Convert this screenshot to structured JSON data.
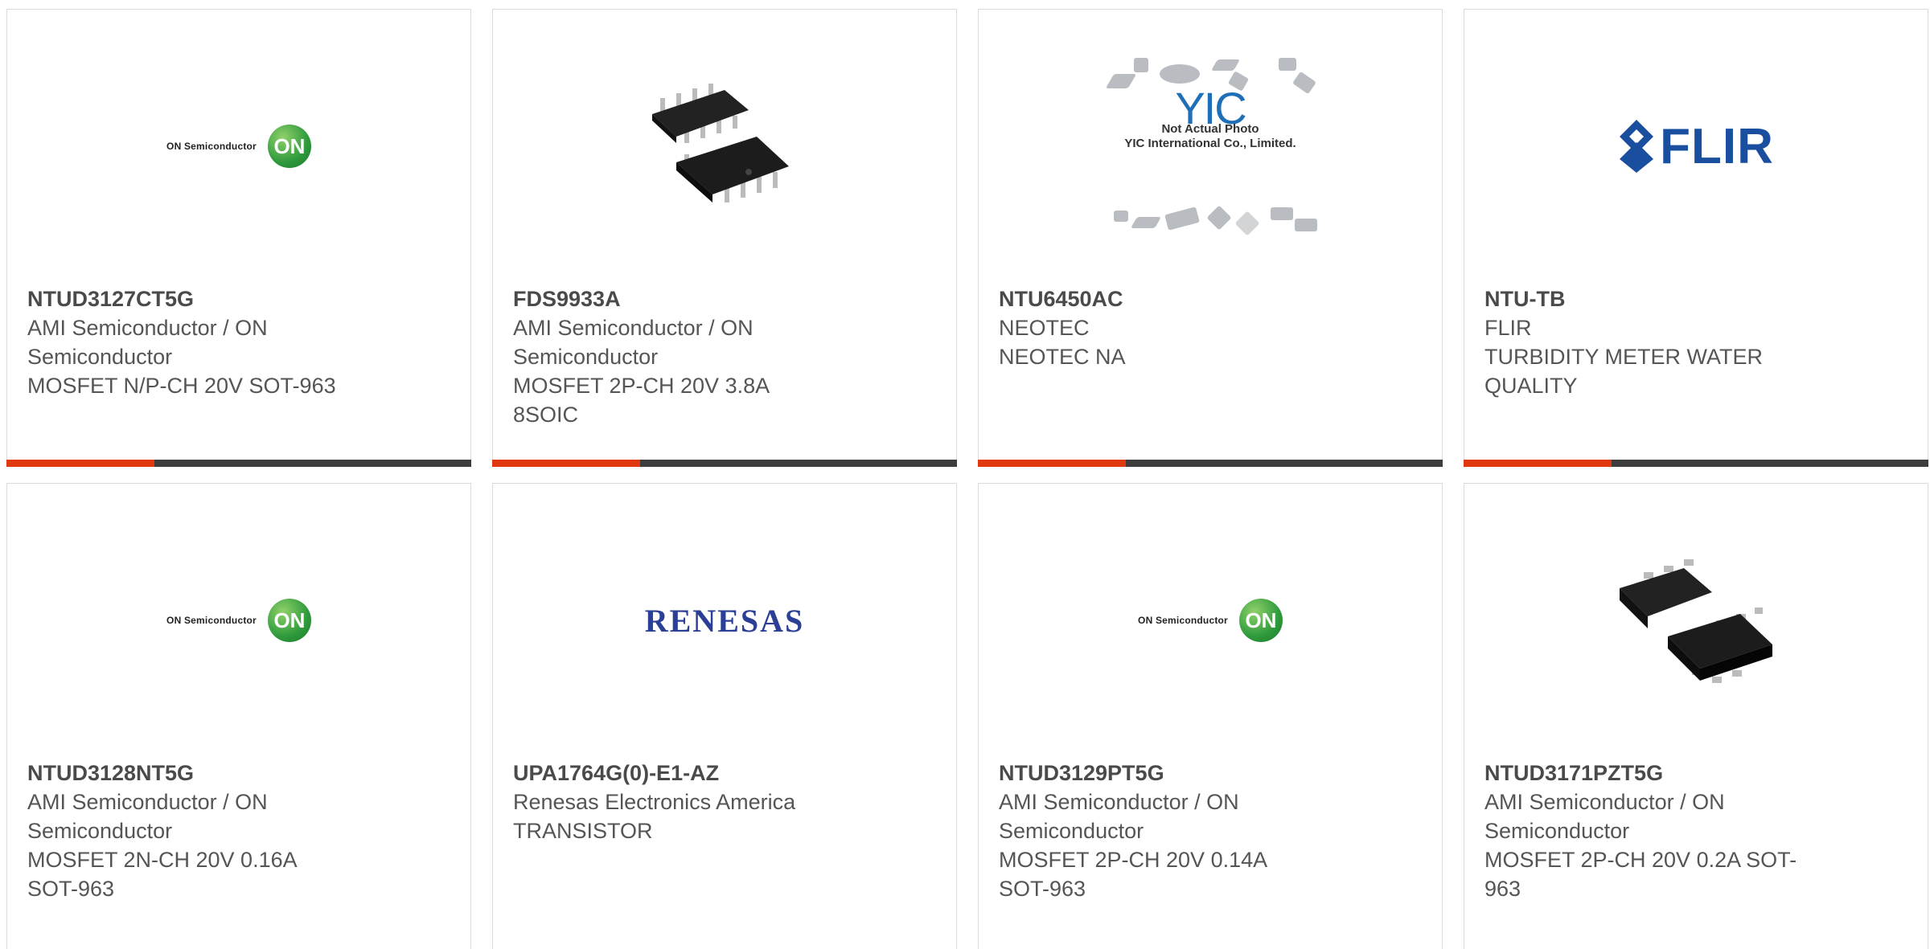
{
  "products": [
    {
      "part_number": "NTUD3127CT5G",
      "manufacturer_lines": [
        "AMI Semiconductor / ON",
        "Semiconductor"
      ],
      "description_lines": [
        "MOSFET N/P-CH 20V SOT-963"
      ],
      "logo": {
        "type": "on",
        "text": "ON Semiconductor",
        "badge": "ON"
      }
    },
    {
      "part_number": "FDS9933A",
      "manufacturer_lines": [
        "AMI Semiconductor / ON",
        "Semiconductor"
      ],
      "description_lines": [
        "MOSFET 2P-CH 20V 3.8A",
        "8SOIC"
      ],
      "logo": {
        "type": "chip-soic"
      }
    },
    {
      "part_number": "NTU6450AC",
      "manufacturer_lines": [
        "NEOTEC"
      ],
      "description_lines": [
        "NEOTEC NA"
      ],
      "logo": {
        "type": "yic",
        "mark": "YIC",
        "caption1": "Not Actual Photo",
        "caption2": "YIC International Co., Limited."
      }
    },
    {
      "part_number": "NTU-TB",
      "manufacturer_lines": [
        "FLIR"
      ],
      "description_lines": [
        "TURBIDITY METER WATER",
        "QUALITY"
      ],
      "logo": {
        "type": "flir",
        "text": "FLIR"
      }
    },
    {
      "part_number": "NTUD3128NT5G",
      "manufacturer_lines": [
        "AMI Semiconductor / ON",
        "Semiconductor"
      ],
      "description_lines": [
        "MOSFET 2N-CH 20V 0.16A",
        "SOT-963"
      ],
      "logo": {
        "type": "on",
        "text": "ON Semiconductor",
        "badge": "ON"
      }
    },
    {
      "part_number": "UPA1764G(0)-E1-AZ",
      "manufacturer_lines": [
        "Renesas Electronics America"
      ],
      "description_lines": [
        "TRANSISTOR"
      ],
      "logo": {
        "type": "renesas",
        "text": "RENESAS"
      }
    },
    {
      "part_number": "NTUD3129PT5G",
      "manufacturer_lines": [
        "AMI Semiconductor / ON",
        "Semiconductor"
      ],
      "description_lines": [
        "MOSFET 2P-CH 20V 0.14A",
        "SOT-963"
      ],
      "logo": {
        "type": "on",
        "text": "ON Semiconductor",
        "badge": "ON"
      }
    },
    {
      "part_number": "NTUD3171PZT5G",
      "manufacturer_lines": [
        "AMI Semiconductor / ON",
        "Semiconductor"
      ],
      "description_lines": [
        "MOSFET 2P-CH 20V 0.2A SOT-",
        "963"
      ],
      "logo": {
        "type": "chip-sot"
      }
    }
  ],
  "colors": {
    "accent": "#e0380f",
    "bar": "#3d3d3d",
    "text": "#555555"
  }
}
